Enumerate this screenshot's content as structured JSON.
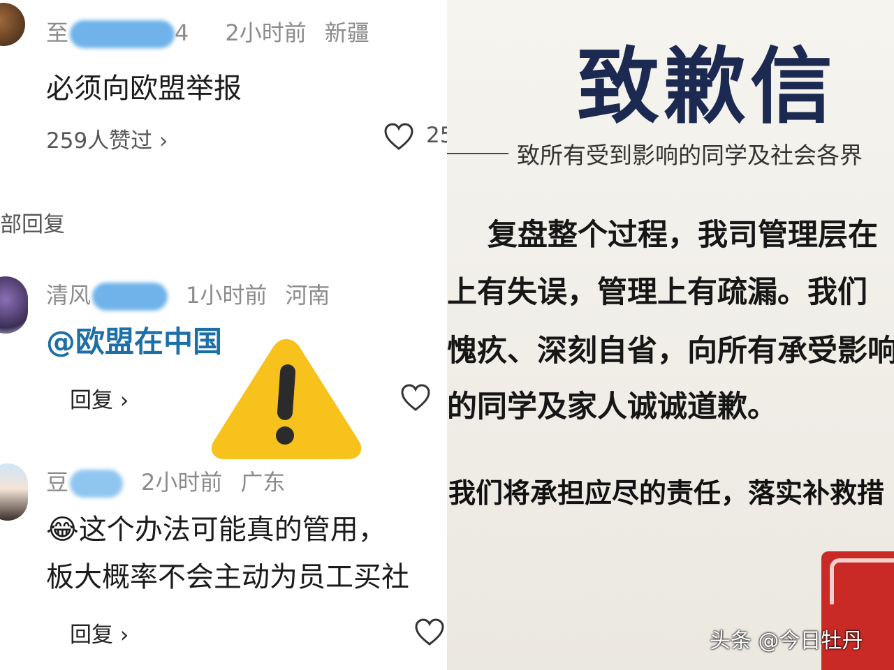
{
  "comments": {
    "top": {
      "user_prefix": "至",
      "user_suffix": "4",
      "time": "2小时前",
      "location": "新疆",
      "text": "必须向欧盟举报",
      "likes_label": "259人赞过 ›",
      "like_count_partial": "25"
    },
    "replies_header": "部回复",
    "reply1": {
      "user_prefix": "清风",
      "time": "1小时前",
      "location": "河南",
      "text": "@欧盟在中国",
      "reply_label": "回复 ›"
    },
    "reply2": {
      "user_prefix": "豆",
      "time": "2小时前",
      "location": "广东",
      "emoji": "😂",
      "text_line1": "这个办法可能真的管用，",
      "text_line2": "板大概率不会主动为员工买社",
      "reply_label": "回复 ›"
    }
  },
  "warning_icon": "warning-triangle-icon",
  "letter": {
    "title": "致歉信",
    "addressee": "致所有受到影响的同学及社会各界",
    "lines": [
      "复盘整个过程，我司管理层在",
      "上有失误，管理上有疏漏。我们",
      "愧疚、深刻自省，向所有承受影响",
      "的同学及家人诚诚道歉。"
    ],
    "commitment": "我们将承担应尽的责任，落实补救措"
  },
  "watermark": "头条 @今日牡丹",
  "colors": {
    "mention": "#1d6fa8",
    "title": "#1c2a52",
    "stamp": "#c92a26",
    "warning": "#f6c21b"
  }
}
